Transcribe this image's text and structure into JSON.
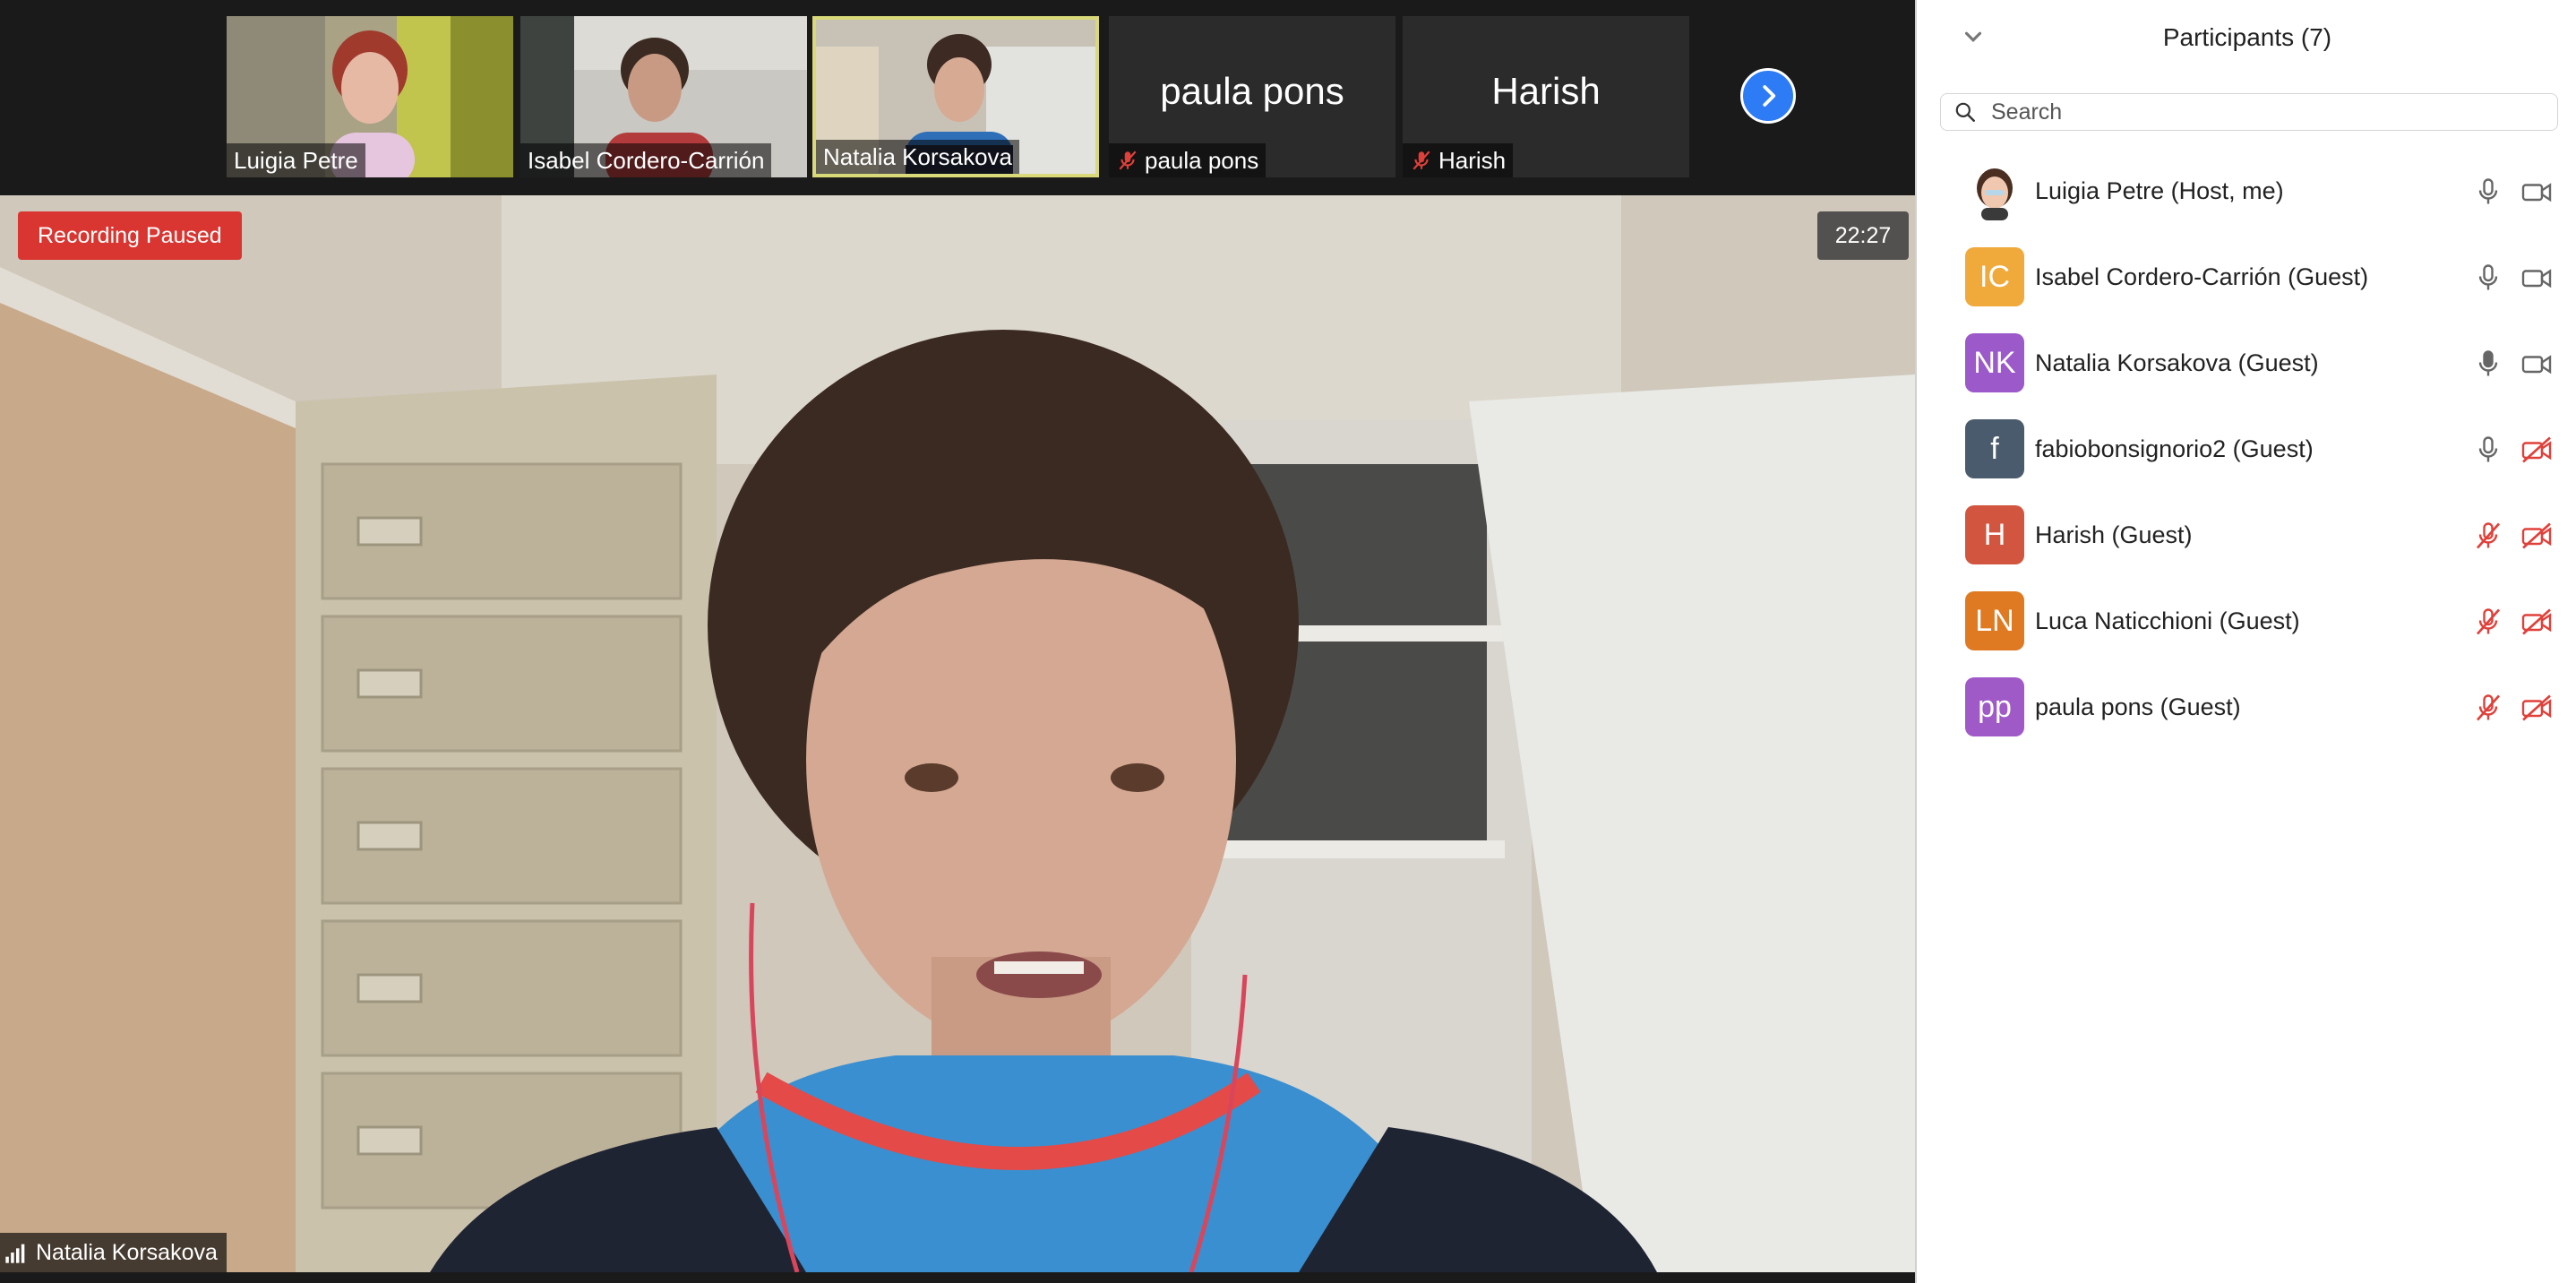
{
  "recording_badge": "Recording Paused",
  "meeting_timer": "22:27",
  "active_speaker": "Natalia Korsakova",
  "thumbnails": [
    {
      "name": "Luigia Petre",
      "video": true,
      "muted": false
    },
    {
      "name": "Isabel Cordero-Carrión",
      "video": true,
      "muted": false
    },
    {
      "name": "Natalia Korsakova",
      "video": true,
      "muted": false,
      "active": true
    },
    {
      "name": "paula pons",
      "video": false,
      "muted": true
    },
    {
      "name": "Harish",
      "video": false,
      "muted": true
    }
  ],
  "panel": {
    "title": "Participants (7)",
    "search_placeholder": "Search"
  },
  "participants": [
    {
      "initials": "",
      "name": "Luigia Petre (Host, me)",
      "color": "#ffffff",
      "mic": "on",
      "video": "on"
    },
    {
      "initials": "IC",
      "name": "Isabel Cordero-Carrión (Guest)",
      "color": "#f0a93b",
      "mic": "on",
      "video": "on"
    },
    {
      "initials": "NK",
      "name": "Natalia Korsakova (Guest)",
      "color": "#9b59c9",
      "mic": "speaking",
      "video": "on"
    },
    {
      "initials": "f",
      "name": "fabiobonsignorio2 (Guest)",
      "color": "#4a5b6d",
      "mic": "on",
      "video": "off"
    },
    {
      "initials": "H",
      "name": "Harish (Guest)",
      "color": "#d2553f",
      "mic": "off",
      "video": "off"
    },
    {
      "initials": "LN",
      "name": "Luca Naticchioni (Guest)",
      "color": "#e07a22",
      "mic": "off",
      "video": "off"
    },
    {
      "initials": "pp",
      "name": "paula pons (Guest)",
      "color": "#a05ac8",
      "mic": "off",
      "video": "off"
    }
  ],
  "colors": {
    "accent": "#2d7cf6",
    "recording": "#d93531",
    "muted": "#e0403a"
  }
}
